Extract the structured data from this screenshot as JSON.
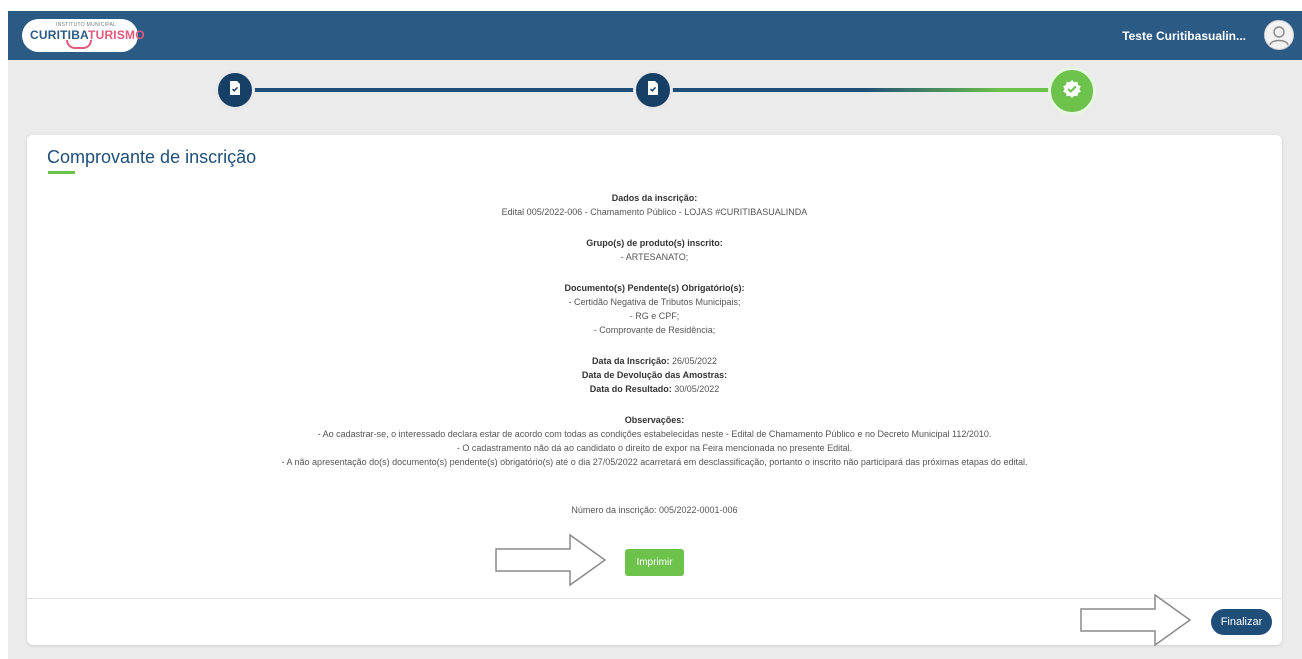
{
  "header": {
    "logo_small": "INSTITUTO MUNICIPAL",
    "logo_main_a": "CURITIBA",
    "logo_main_b": "TURISMO",
    "username": "Teste Curitibasualin..."
  },
  "stepper": {
    "steps": [
      {
        "icon": "document-check-icon",
        "state": "done"
      },
      {
        "icon": "document-check-icon",
        "state": "done"
      },
      {
        "icon": "verified-badge-icon",
        "state": "current"
      }
    ]
  },
  "card": {
    "title": "Comprovante de inscrição",
    "dados_label": "Dados da inscrição:",
    "dados_value": "Edital 005/2022-006 - Chamamento Público - LOJAS #CURITIBASUALINDA",
    "grupos_label": "Grupo(s) de produto(s) inscrito:",
    "grupos": [
      "- ARTESANATO;"
    ],
    "docs_label": "Documento(s) Pendente(s) Obrigatório(s):",
    "docs": [
      "- Certidão Negativa de Tributos Municipais;",
      "- RG e CPF;",
      "- Comprovante de Residência;"
    ],
    "data_inscricao_label": "Data da Inscrição:",
    "data_inscricao_value": "26/05/2022",
    "data_devolucao_label": "Data de Devolução das Amostras:",
    "data_resultado_label": "Data do Resultado:",
    "data_resultado_value": "30/05/2022",
    "obs_label": "Observações:",
    "obs": [
      "- Ao cadastrar-se, o interessado declara estar de acordo com todas as condições estabelecidas neste - Edital de Chamamento Público e no Decreto Municipal 112/2010.",
      "- O cadastramento não dá ao candidato o direito de expor na Feira mencionada no presente Edital.",
      "- A não apresentação do(s) documento(s) pendente(s) obrigatório(s) até o dia 27/05/2022 acarretará em desclassificação, portanto o inscrito não participará das próximas etapas do edital."
    ],
    "numero_label": "Número da inscrição:",
    "numero_value": "005/2022-0001-006",
    "print_label": "Imprimir",
    "finalize_label": "Finalizar"
  },
  "colors": {
    "header": "#2b5a85",
    "primary": "#1f4e79",
    "accent_green": "#6cc24a"
  }
}
